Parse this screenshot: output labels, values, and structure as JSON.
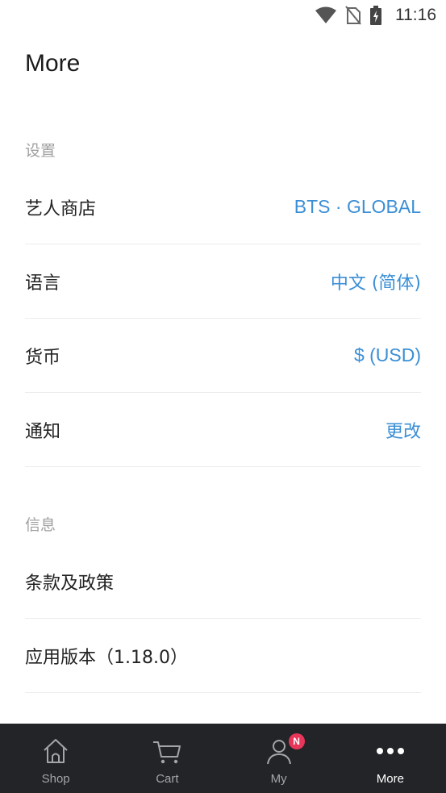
{
  "status_bar": {
    "time": "11:16",
    "icons": [
      "wifi-icon",
      "no-sim-icon",
      "battery-charging-icon"
    ]
  },
  "page": {
    "title": "More"
  },
  "settings_section": {
    "header": "设置",
    "rows": [
      {
        "label": "艺人商店",
        "value": "BTS · GLOBAL"
      },
      {
        "label": "语言",
        "value": "中文 (简体)"
      },
      {
        "label": "货币",
        "value": "$ (USD)"
      },
      {
        "label": "通知",
        "value": "更改"
      }
    ]
  },
  "info_section": {
    "header": "信息",
    "rows": [
      {
        "label": "条款及政策"
      },
      {
        "label": "应用版本（1.18.0）"
      }
    ]
  },
  "bottom_nav": {
    "items": [
      {
        "label": "Shop",
        "icon": "home-icon"
      },
      {
        "label": "Cart",
        "icon": "cart-icon"
      },
      {
        "label": "My",
        "icon": "person-icon",
        "badge": "N"
      },
      {
        "label": "More",
        "icon": "more-dots-icon",
        "active": true
      }
    ]
  },
  "colors": {
    "accent": "#3b8fd6",
    "nav_background": "#222427",
    "badge": "#e8365a",
    "section_header": "#a0a0a0"
  }
}
